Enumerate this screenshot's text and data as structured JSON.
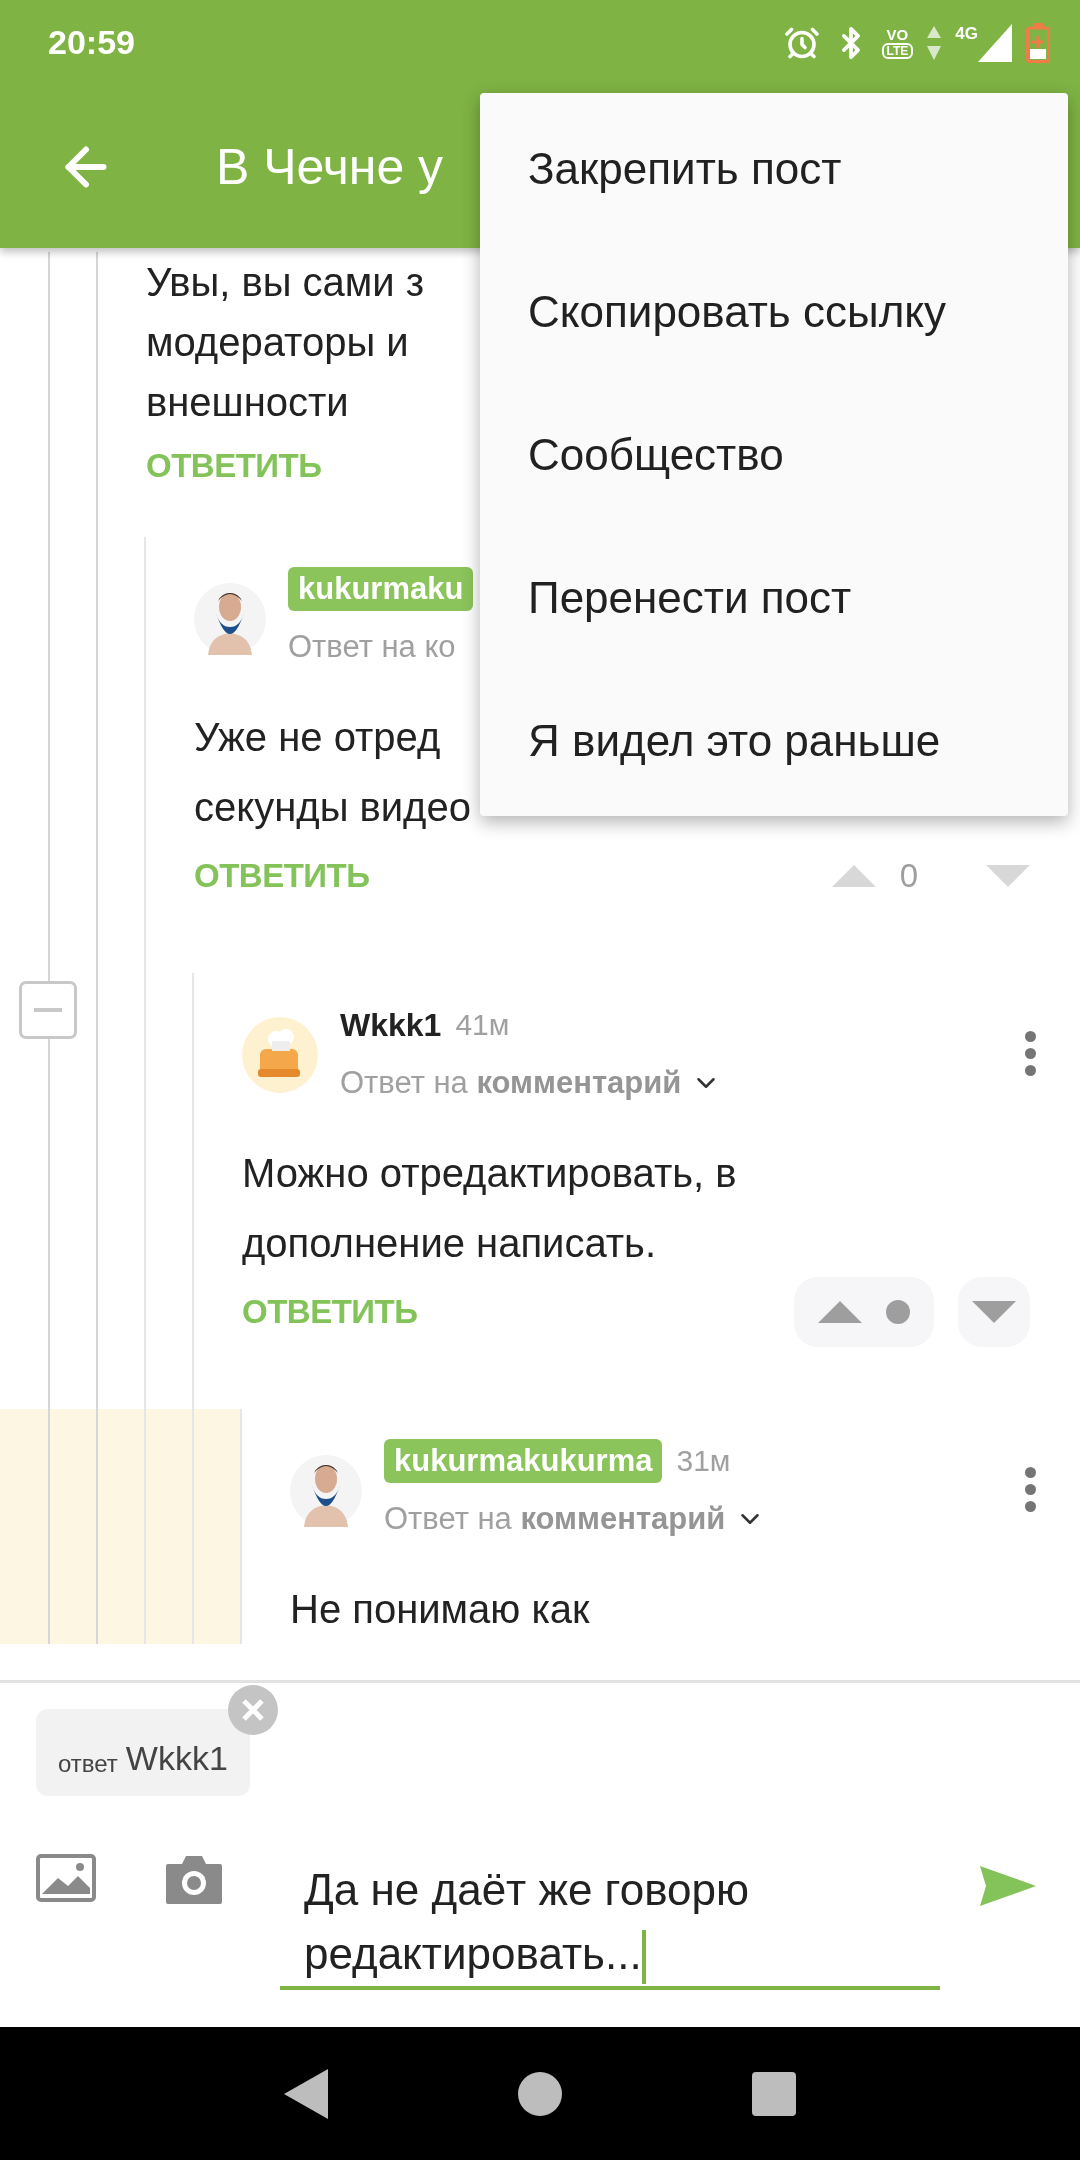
{
  "status_bar": {
    "time": "20:59",
    "volte": [
      "VO",
      "LTE"
    ],
    "network_type": "4G"
  },
  "toolbar": {
    "title": "В Чечне у"
  },
  "overflow_menu": {
    "items": [
      "Закрепить пост",
      "Скопировать ссылку",
      "Сообщество",
      "Перенести пост",
      "Я видел это раньше"
    ]
  },
  "comments": [
    {
      "body_lines": [
        "Увы, вы сами з",
        "модераторы и",
        "внешности"
      ],
      "reply_label": "ОТВЕТИТЬ",
      "highlighted": false,
      "children": [
        {
          "author": "kukurmaku",
          "author_badge": true,
          "avatar": {
            "kind": "photo"
          },
          "reply_to": "Ответ на ко",
          "more_button": false,
          "body_lines": [
            "Уже не отред",
            "секунды видео"
          ],
          "reply_label": "ОТВЕТИТЬ",
          "votes": {
            "kind": "score",
            "score": "0"
          },
          "highlighted": false,
          "children": [
            {
              "author": "Wkkk1",
              "author_badge": false,
              "time": "41м",
              "avatar": {
                "kind": "cartoon"
              },
              "reply_to": "Ответ на **комментарий**",
              "reply_to_expandable": true,
              "more_button": true,
              "collapse": {
                "expanded": true
              },
              "body_lines": [
                "Можно отредактировать, в",
                "дополнение написать."
              ],
              "reply_label": "ОТВЕТИТЬ",
              "votes": {
                "kind": "hidden"
              },
              "highlighted": false,
              "children": [
                {
                  "author": "kukurmakukurma",
                  "author_badge": true,
                  "time": "31м",
                  "avatar": {
                    "kind": "photo"
                  },
                  "reply_to": "Ответ на **комментарий**",
                  "reply_to_expandable": true,
                  "more_button": true,
                  "body_lines": [
                    "Не понимаю как"
                  ],
                  "highlighted": true
                }
              ]
            }
          ]
        }
      ]
    }
  ],
  "composer": {
    "reply_target": {
      "label": "ответ",
      "name": "Wkkk1"
    },
    "value": "Да не даёт же говорю редактировать..."
  }
}
